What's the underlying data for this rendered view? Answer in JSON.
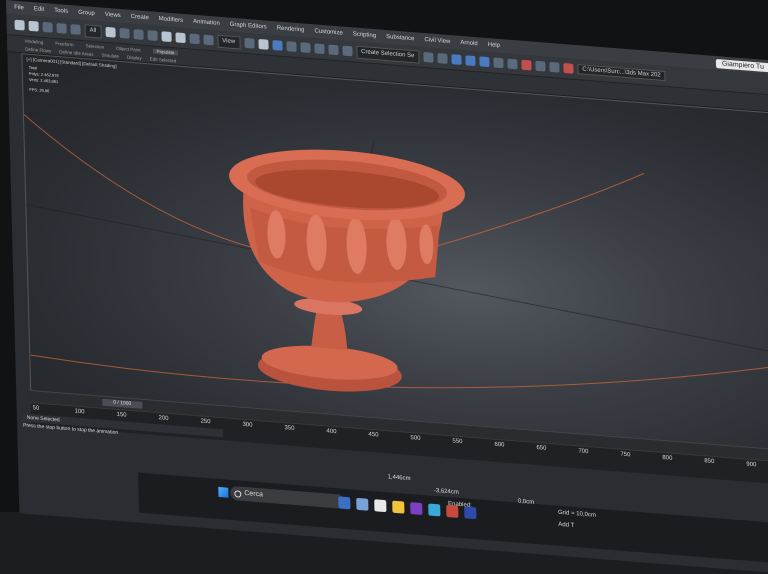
{
  "menubar": {
    "items": [
      "File",
      "Edit",
      "Tools",
      "Group",
      "Views",
      "Create",
      "Modifiers",
      "Animation",
      "Graph Editors",
      "Rendering",
      "Customize",
      "Scripting",
      "Substance",
      "Civil View",
      "Arnold",
      "Help"
    ],
    "user": "Giampiero Tu"
  },
  "toolbar": {
    "view_dropdown": "View",
    "selection_set": "Create Selection Se",
    "project_path": "C:\\Users\\Surc...\\3ds Max 202"
  },
  "ribbon": {
    "row1": [
      "Modeling",
      "Freeform",
      "Selection",
      "Object Paint"
    ],
    "populate": "Populate",
    "row2": [
      "Define Flows",
      "Define Idle Areas",
      "Simulate",
      "Display",
      "Edit Selected"
    ]
  },
  "viewport": {
    "label": "[+] [Camera001] [Standard] [Default Shading]",
    "stats_title": "Total",
    "polys_label": "Polys:",
    "polys_value": "2.462.976",
    "verts_label": "Verts:",
    "verts_value": "2.463.861",
    "fps_label": "FPS:",
    "fps_value": "29,96"
  },
  "timeslider": {
    "frame": "0 / 1000"
  },
  "track": {
    "ticks": [
      "50",
      "100",
      "150",
      "200",
      "250",
      "300",
      "350",
      "400",
      "450",
      "500",
      "550",
      "600",
      "650",
      "700",
      "750",
      "800",
      "850",
      "900"
    ]
  },
  "status": {
    "selection": "None Selected",
    "prompt": "Press the stop button to stop the animation"
  },
  "taskbar": {
    "search_placeholder": "Cerca",
    "x_value": "1,446cm",
    "y_value": "-3,624cm",
    "z_value": "0,0cm",
    "enabled_label": "Enabled:",
    "grid_label": "Grid = 10,0cm",
    "add_label": "Add T"
  },
  "colors": {
    "terracotta": "#d4684f",
    "viewport_bg": "#3b3f45",
    "orbit_line": "#c8643c"
  }
}
